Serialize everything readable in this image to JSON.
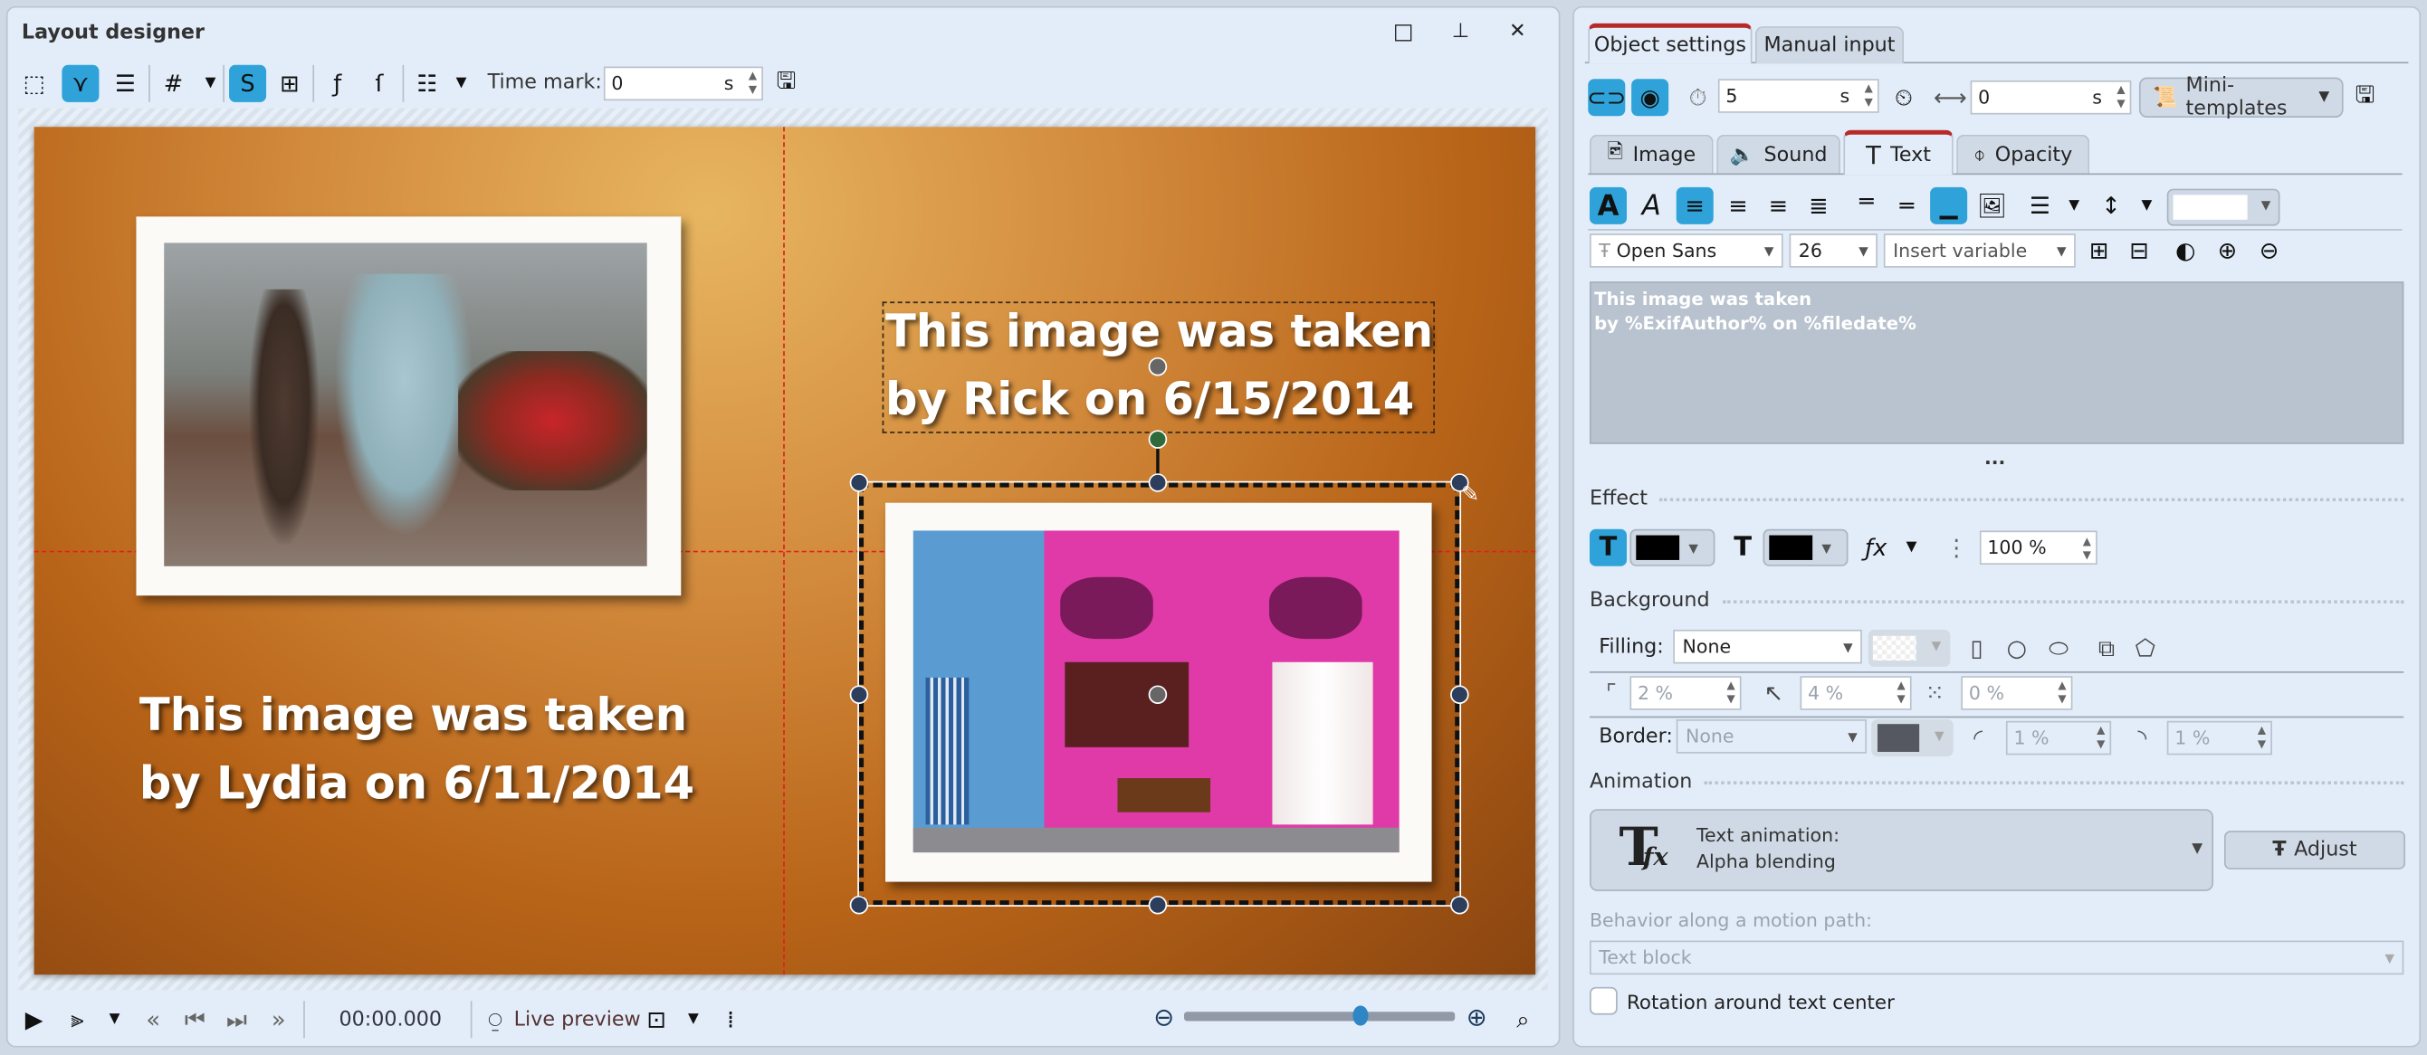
{
  "designer": {
    "title": "Layout designer",
    "window_buttons": {
      "maximize": "□",
      "pin": "⊥",
      "close": "✕"
    },
    "time_mark_label": "Time mark:",
    "time_mark_value": "0",
    "time_mark_unit": "s",
    "canvas": {
      "text_left": [
        "This image was taken",
        "by Lydia on 6/11/2014"
      ],
      "text_right": [
        "This image was taken",
        "by Rick on 6/15/2014"
      ]
    },
    "transport": {
      "time": "00:00.000",
      "live_preview": "Live preview",
      "zoom_level_fraction": 0.65
    }
  },
  "settings": {
    "tabs": [
      "Object settings",
      "Manual input"
    ],
    "active_tab": 0,
    "duration_value": "5",
    "duration_unit": "s",
    "offset_value": "0",
    "offset_unit": "s",
    "mini_templates": "Mini-templates",
    "sub_tabs": [
      "Image",
      "Sound",
      "Text",
      "Opacity"
    ],
    "active_sub_tab": 2,
    "font": "Open Sans",
    "font_size": "26",
    "insert_variable": "Insert variable",
    "text_content": [
      "This image was taken",
      "by %ExifAuthor% on %filedate%"
    ],
    "more": "...",
    "effect": {
      "label": "Effect",
      "opacity": "100 %",
      "color1": "#000000",
      "color2": "#000000"
    },
    "background": {
      "label": "Background",
      "filling_label": "Filling:",
      "filling_value": "None",
      "v1": "2 %",
      "v2": "4 %",
      "v3": "0 %",
      "border_label": "Border:",
      "border_value": "None",
      "b1": "1 %",
      "b2": "1 %",
      "border_color": "#555860"
    },
    "animation": {
      "label": "Animation",
      "title": "Text animation:",
      "value": "Alpha blending",
      "adjust": "Adjust",
      "behavior_label": "Behavior along a motion path:",
      "behavior_value": "Text block",
      "rotation_label": "Rotation around text center",
      "rotation_checked": false
    }
  },
  "colors": {
    "accent": "#2fa3d9",
    "tab_indicator": "#b62a2a",
    "guide": "#e02020"
  }
}
